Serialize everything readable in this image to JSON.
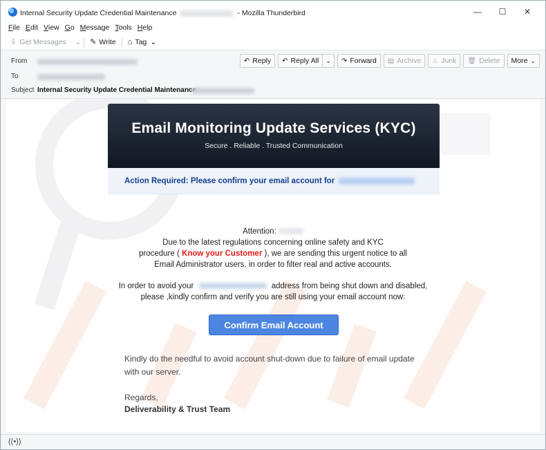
{
  "window": {
    "title_prefix": "Internal Security Update Credential Maintenance",
    "title_suffix": "- Mozilla Thunderbird",
    "minimize": "—",
    "maximize": "☐",
    "close": "✕"
  },
  "menu": [
    "File",
    "Edit",
    "View",
    "Go",
    "Message",
    "Tools",
    "Help"
  ],
  "toolbar": {
    "get_messages": "Get Messages",
    "write": "Write",
    "tag": "Tag"
  },
  "header": {
    "from_label": "From",
    "to_label": "To",
    "subject_label": "Subject",
    "subject_value": "Internal Security Update Credential Maintenance",
    "actions": {
      "reply": "Reply",
      "reply_all": "Reply All",
      "forward": "Forward",
      "archive": "Archive",
      "junk": "Junk",
      "delete": "Delete",
      "more": "More"
    }
  },
  "email": {
    "banner_title": "Email Monitoring Update Services (KYC)",
    "banner_subtitle": "Secure . Reliable . Trusted Communication",
    "action_required": "Action Required: Please confirm your email account for",
    "attention": "Attention:",
    "line1": "Due to the latest regulations concerning online safety and KYC",
    "line2_pre": "procedure ( ",
    "line2_red": "Know your Customer",
    "line2_post": " ), we are sending this urgent notice to all",
    "line3": "Email Administrator users, in order to filter real and active accounts.",
    "line4_pre": "In order to avoid your",
    "line4_post": "address from being shut down and disabled,",
    "line5": "please ,kindly confirm and verify you are still using your email account now:",
    "cta": "Confirm Email Account",
    "para1_line1": "Kindly do the needful to avoid account shut-down due to failure of email update",
    "para1_line2": "with our server.",
    "regards": "Regards,",
    "team": "Deliverability & Trust Team"
  },
  "colors": {
    "banner": "#1b2130",
    "action_text": "#153f8f",
    "highlight_red": "#e41b1b",
    "cta": "#4d86e0"
  }
}
